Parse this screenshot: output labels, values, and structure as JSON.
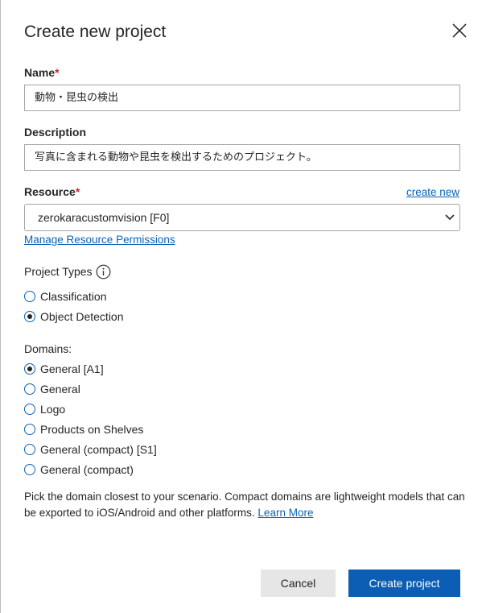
{
  "dialog": {
    "title": "Create new project",
    "close_icon": "close-icon"
  },
  "name": {
    "label": "Name",
    "required_mark": "*",
    "value": "動物・昆虫の検出"
  },
  "description": {
    "label": "Description",
    "value": "写真に含まれる動物や昆虫を検出するためのプロジェクト。"
  },
  "resource": {
    "label": "Resource",
    "required_mark": "*",
    "create_link": "create new",
    "selected": "zerokaracustomvision [F0]",
    "manage_link": "Manage Resource Permissions"
  },
  "project_types": {
    "label": "Project Types",
    "info_icon": "info-icon",
    "options": [
      {
        "label": "Classification",
        "checked": false
      },
      {
        "label": "Object Detection",
        "checked": true
      }
    ]
  },
  "domains": {
    "label": "Domains:",
    "options": [
      {
        "label": "General [A1]",
        "checked": true
      },
      {
        "label": "General",
        "checked": false
      },
      {
        "label": "Logo",
        "checked": false
      },
      {
        "label": "Products on Shelves",
        "checked": false
      },
      {
        "label": "General (compact) [S1]",
        "checked": false
      },
      {
        "label": "General (compact)",
        "checked": false
      }
    ]
  },
  "help": {
    "text": "Pick the domain closest to your scenario. Compact domains are lightweight models that can be exported to iOS/Android and other platforms. ",
    "link": "Learn More"
  },
  "buttons": {
    "cancel": "Cancel",
    "create": "Create project"
  },
  "colors": {
    "accent": "#0b5eb3",
    "link": "#0a63b4",
    "required": "#c4262e"
  }
}
